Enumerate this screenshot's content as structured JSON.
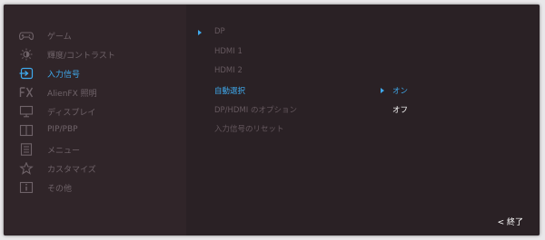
{
  "menu": {
    "items": [
      {
        "label": "ゲーム",
        "icon": "gamepad-icon"
      },
      {
        "label": "輝度/コントラスト",
        "icon": "brightness-icon"
      },
      {
        "label": "入力信号",
        "icon": "input-source-icon"
      },
      {
        "label": "AlienFX 照明",
        "icon": "alienfx-icon"
      },
      {
        "label": "ディスプレイ",
        "icon": "monitor-icon"
      },
      {
        "label": "PIP/PBP",
        "icon": "pip-icon"
      },
      {
        "label": "メニュー",
        "icon": "menu-icon"
      },
      {
        "label": "カスタマイズ",
        "icon": "star-icon"
      },
      {
        "label": "その他",
        "icon": "info-icon"
      }
    ],
    "active_index": 2
  },
  "input_options": [
    "DP",
    "HDMI 1",
    "HDMI 2",
    "自動選択",
    "DP/HDMI のオプション",
    "入力信号のリセット"
  ],
  "auto_select_options": [
    "オン",
    "オフ"
  ],
  "exit_label": "< 終了",
  "colors": {
    "accent": "#3fa9ec",
    "background": "#2b2226",
    "inactive_text": "#6f6369"
  }
}
